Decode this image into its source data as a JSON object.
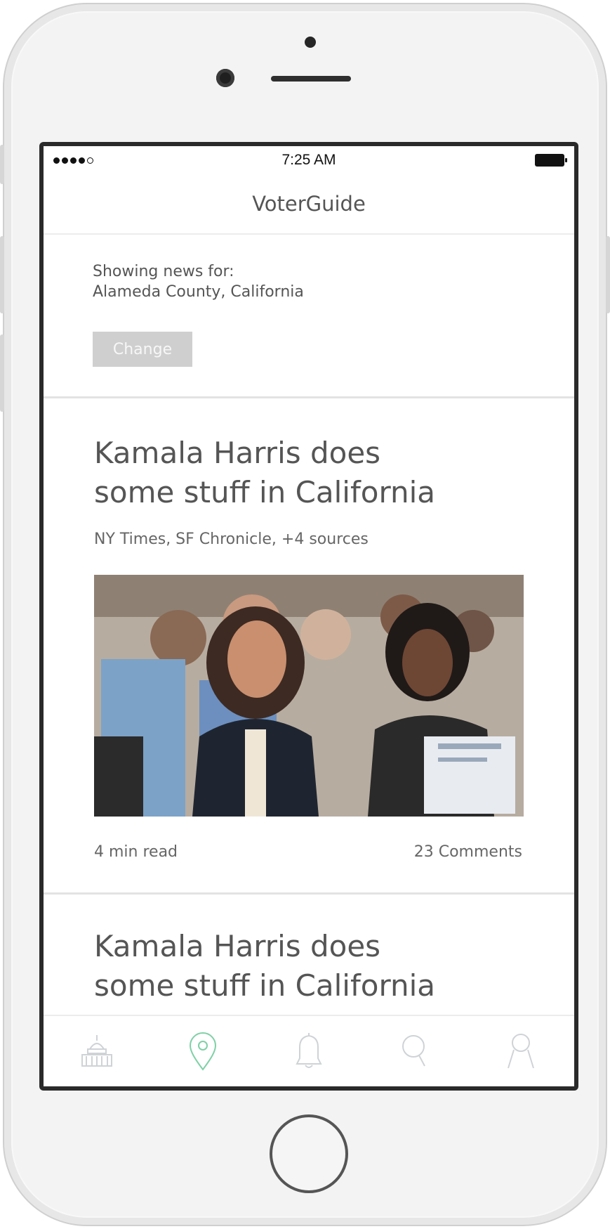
{
  "status_bar": {
    "time": "7:25 AM"
  },
  "header": {
    "title": "VoterGuide"
  },
  "location": {
    "label": "Showing news for:",
    "value": "Alameda County, California",
    "change_label": "Change"
  },
  "articles": [
    {
      "title_line1": "Kamala Harris does",
      "title_line2": "some stuff in California",
      "sources": "NY Times, SF Chronicle, +4 sources",
      "read_time": "4 min read",
      "comments": "23 Comments"
    },
    {
      "title_line1": "Kamala Harris does",
      "title_line2": "some stuff in California"
    }
  ],
  "tab_bar": {
    "icons": [
      "capitol-icon",
      "location-pin-icon",
      "bell-icon",
      "search-icon",
      "profile-icon"
    ],
    "active_color": "#7fd0a6",
    "inactive_color": "#cfd3d6"
  }
}
